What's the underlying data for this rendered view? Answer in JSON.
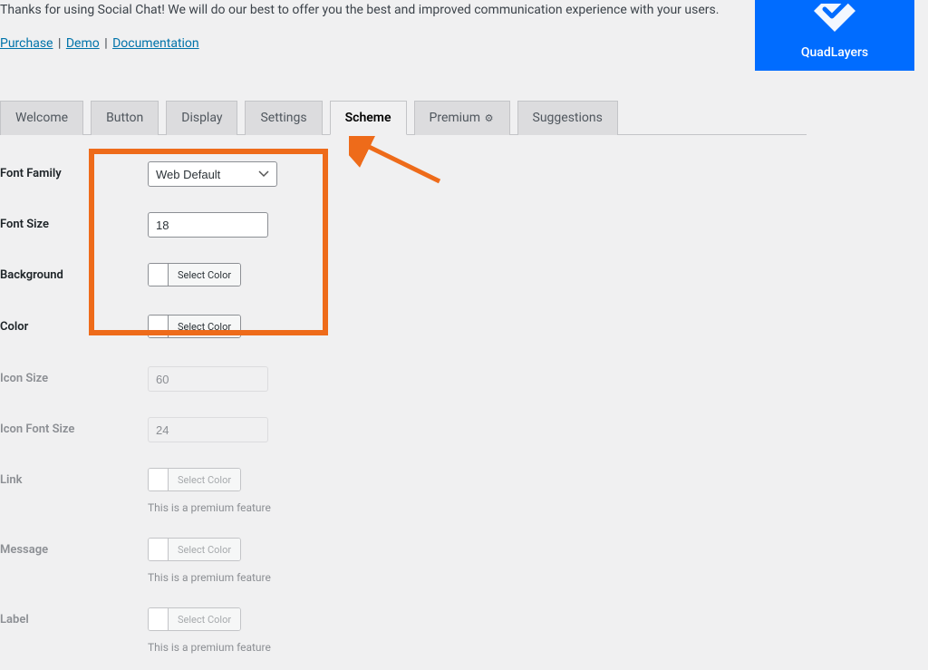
{
  "intro": {
    "text": "Thanks for using Social Chat! We will do our best to offer you the best and improved communication experience with your users."
  },
  "links": {
    "purchase": "Purchase",
    "demo": "Demo",
    "documentation": "Documentation"
  },
  "brand": {
    "name": "QuadLayers"
  },
  "tabs": {
    "welcome": "Welcome",
    "button": "Button",
    "display": "Display",
    "settings": "Settings",
    "scheme": "Scheme",
    "premium": "Premium",
    "suggestions": "Suggestions"
  },
  "form": {
    "font_family": {
      "label": "Font Family",
      "value": "Web Default"
    },
    "font_size": {
      "label": "Font Size",
      "value": "18"
    },
    "background": {
      "label": "Background",
      "button": "Select Color"
    },
    "color": {
      "label": "Color",
      "button": "Select Color"
    },
    "icon_size": {
      "label": "Icon Size",
      "value": "60"
    },
    "icon_font_size": {
      "label": "Icon Font Size",
      "value": "24"
    },
    "link": {
      "label": "Link",
      "button": "Select Color",
      "note": "This is a premium feature"
    },
    "message": {
      "label": "Message",
      "button": "Select Color",
      "note": "This is a premium feature"
    },
    "label_field": {
      "label": "Label",
      "button": "Select Color",
      "note": "This is a premium feature"
    }
  }
}
